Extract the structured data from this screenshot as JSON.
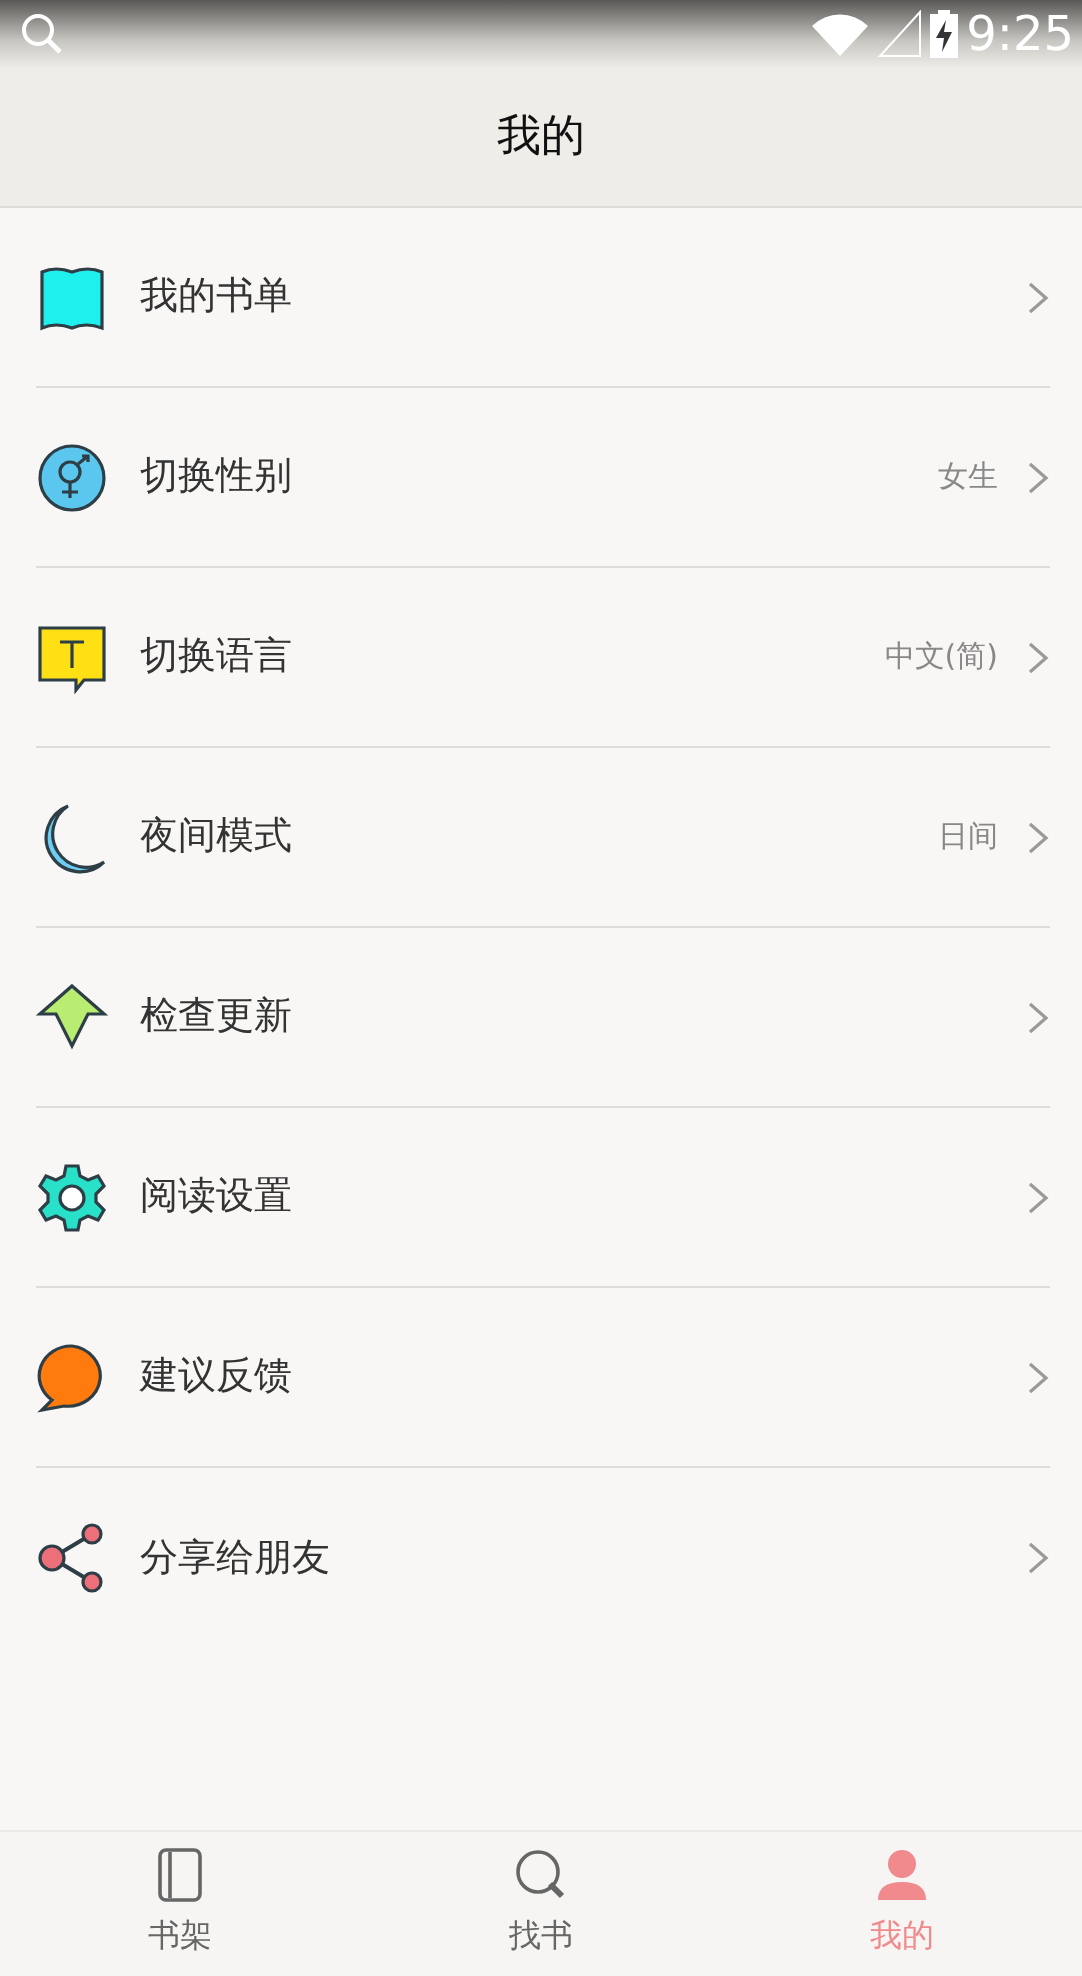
{
  "status_bar": {
    "time": "9:25"
  },
  "header": {
    "title": "我的"
  },
  "menu": [
    {
      "label": "我的书单"
    },
    {
      "label": "切换性别",
      "value": "女生"
    },
    {
      "label": "切换语言",
      "value": "中文(简)"
    },
    {
      "label": "夜间模式",
      "value": "日间"
    },
    {
      "label": "检查更新"
    },
    {
      "label": "阅读设置"
    },
    {
      "label": "建议反馈"
    },
    {
      "label": "分享给朋友"
    }
  ],
  "tabs": [
    {
      "label": "书架",
      "selected": false
    },
    {
      "label": "找书",
      "selected": false
    },
    {
      "label": "我的",
      "selected": true
    }
  ]
}
